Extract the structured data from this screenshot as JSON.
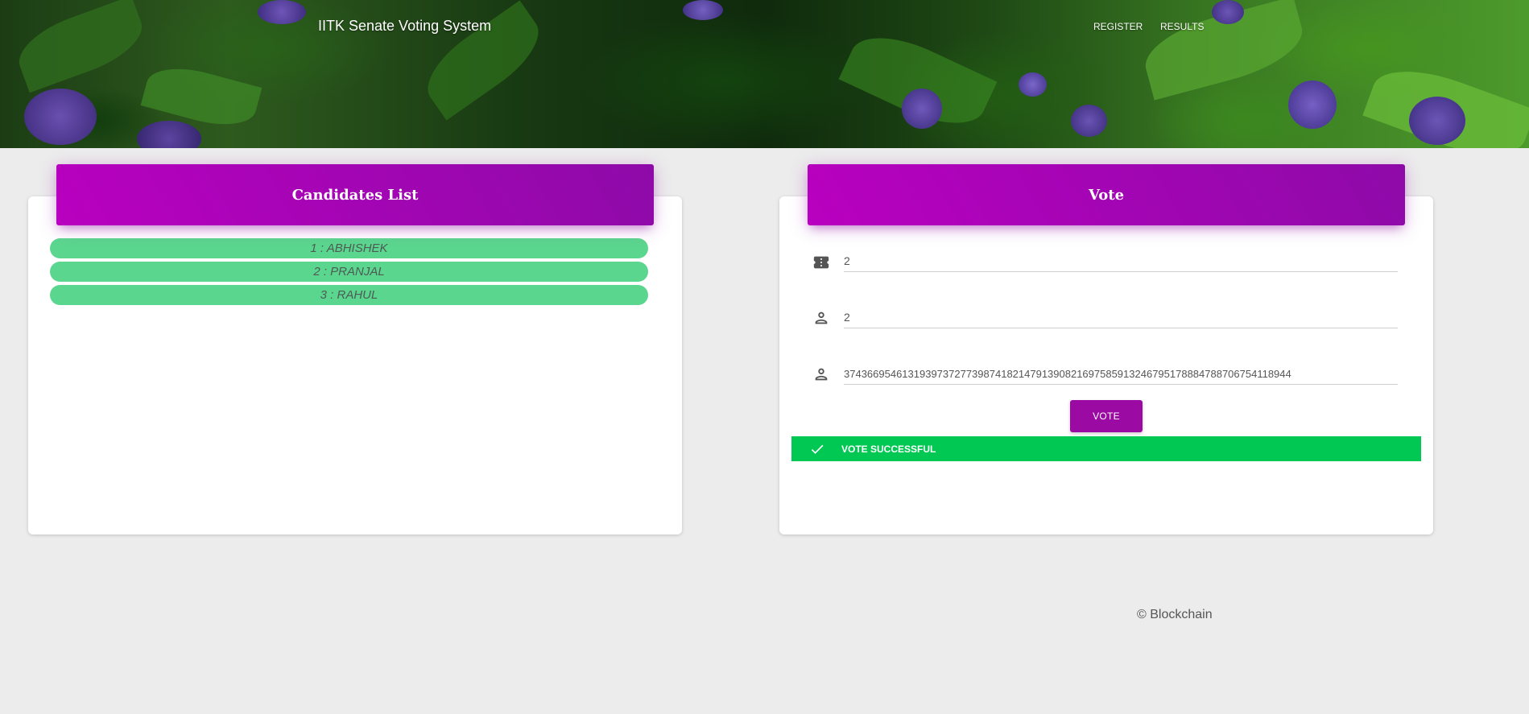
{
  "header": {
    "brand": "IITK Senate Voting System",
    "nav": [
      "REGISTER",
      "RESULTS"
    ]
  },
  "candidates_card": {
    "title": "Candidates List",
    "candidates": [
      "1 : ABHISHEK",
      "2 : PRANJAL",
      "3 : RAHUL"
    ]
  },
  "vote_card": {
    "title": "Vote",
    "fields": [
      {
        "icon": "ticket-icon",
        "value": "2"
      },
      {
        "icon": "person-icon",
        "value": "2"
      },
      {
        "icon": "person-icon",
        "value": "37436695461319397372773987418214791390821697585913246795178884788706754118944"
      }
    ],
    "vote_button": "VOTE",
    "alert": {
      "icon": "check-icon",
      "text": "VOTE SUCCESSFUL"
    }
  },
  "footer": {
    "copyright": "© Blockchain"
  },
  "colors": {
    "card_header_gradient_start": "#b900c0",
    "card_header_gradient_end": "#8e0aa8",
    "candidate_pill": "#5bd68f",
    "vote_button": "#9c0aa4",
    "success_alert": "#00c853",
    "page_background": "#ececec"
  }
}
